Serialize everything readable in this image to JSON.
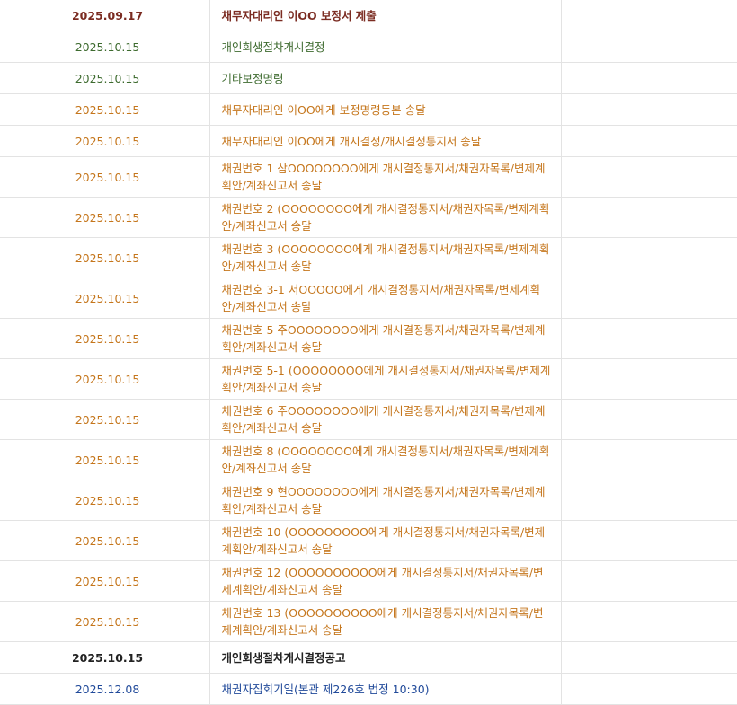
{
  "colors": {
    "dark_red": "#7b2c22",
    "green": "#3e6b2f",
    "orange": "#c5761c",
    "black": "#222222",
    "blue": "#214a9a"
  },
  "rows": [
    {
      "date": "2025.09.17",
      "content": "채무자대리인 이OO 보정서 제출",
      "color": "dark_red",
      "bold": true
    },
    {
      "date": "2025.10.15",
      "content": "개인회생절차개시결정",
      "color": "green",
      "bold": false
    },
    {
      "date": "2025.10.15",
      "content": "기타보정명령",
      "color": "green",
      "bold": false
    },
    {
      "date": "2025.10.15",
      "content": "채무자대리인 이OO에게 보정명령등본 송달",
      "color": "orange",
      "bold": false
    },
    {
      "date": "2025.10.15",
      "content": "채무자대리인 이OO에게 개시결정/개시결정통지서 송달",
      "color": "orange",
      "bold": false
    },
    {
      "date": "2025.10.15",
      "content": "채권번호 1 삼OOOOOOOO에게 개시결정통지서/채권자목록/변제계획안/계좌신고서 송달",
      "color": "orange",
      "bold": false
    },
    {
      "date": "2025.10.15",
      "content": "채권번호 2 (OOOOOOOO에게 개시결정통지서/채권자목록/변제계획안/계좌신고서 송달",
      "color": "orange",
      "bold": false
    },
    {
      "date": "2025.10.15",
      "content": "채권번호 3 (OOOOOOOO에게 개시결정통지서/채권자목록/변제계획안/계좌신고서 송달",
      "color": "orange",
      "bold": false
    },
    {
      "date": "2025.10.15",
      "content": "채권번호 3-1 서OOOOO에게 개시결정통지서/채권자목록/변제계획안/계좌신고서 송달",
      "color": "orange",
      "bold": false
    },
    {
      "date": "2025.10.15",
      "content": "채권번호 5 주OOOOOOOO에게 개시결정통지서/채권자목록/변제계획안/계좌신고서 송달",
      "color": "orange",
      "bold": false
    },
    {
      "date": "2025.10.15",
      "content": "채권번호 5-1 (OOOOOOOO에게 개시결정통지서/채권자목록/변제계획안/계좌신고서 송달",
      "color": "orange",
      "bold": false
    },
    {
      "date": "2025.10.15",
      "content": "채권번호 6 주OOOOOOOO에게 개시결정통지서/채권자목록/변제계획안/계좌신고서 송달",
      "color": "orange",
      "bold": false
    },
    {
      "date": "2025.10.15",
      "content": "채권번호 8 (OOOOOOOO에게 개시결정통지서/채권자목록/변제계획안/계좌신고서 송달",
      "color": "orange",
      "bold": false
    },
    {
      "date": "2025.10.15",
      "content": "채권번호 9 현OOOOOOOO에게 개시결정통지서/채권자목록/변제계획안/계좌신고서 송달",
      "color": "orange",
      "bold": false
    },
    {
      "date": "2025.10.15",
      "content": "채권번호 10 (OOOOOOOOO에게 개시결정통지서/채권자목록/변제계획안/계좌신고서 송달",
      "color": "orange",
      "bold": false
    },
    {
      "date": "2025.10.15",
      "content": "채권번호 12 (OOOOOOOOOO에게 개시결정통지서/채권자목록/변제계획안/계좌신고서 송달",
      "color": "orange",
      "bold": false
    },
    {
      "date": "2025.10.15",
      "content": "채권번호 13 (OOOOOOOOOO에게 개시결정통지서/채권자목록/변제계획안/계좌신고서 송달",
      "color": "orange",
      "bold": false
    },
    {
      "date": "2025.10.15",
      "content": "개인회생절차개시결정공고",
      "color": "black",
      "bold": true
    },
    {
      "date": "2025.12.08",
      "content": "채권자집회기일(본관 제226호 법정 10:30)",
      "color": "blue",
      "bold": false
    }
  ]
}
